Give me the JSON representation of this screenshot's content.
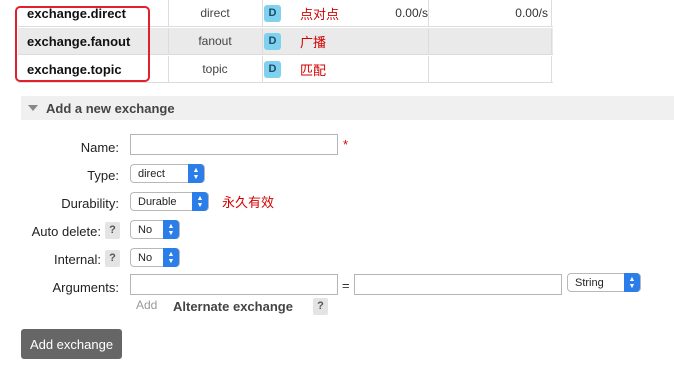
{
  "exchanges": [
    {
      "name": "exchange.direct",
      "type": "direct",
      "features": "D",
      "note": "点对点",
      "rate_in": "0.00/s",
      "rate_out": "0.00/s"
    },
    {
      "name": "exchange.fanout",
      "type": "fanout",
      "features": "D",
      "note": "广播",
      "rate_in": "",
      "rate_out": ""
    },
    {
      "name": "exchange.topic",
      "type": "topic",
      "features": "D",
      "note": "匹配",
      "rate_in": "",
      "rate_out": ""
    }
  ],
  "section": {
    "title": "Add a new exchange"
  },
  "form": {
    "name_label": "Name:",
    "name_value": "",
    "required_mark": "*",
    "type_label": "Type:",
    "type_value": "direct",
    "durability_label": "Durability:",
    "durability_value": "Durable",
    "durability_note": "永久有效",
    "auto_delete_label": "Auto delete:",
    "auto_delete_value": "No",
    "internal_label": "Internal:",
    "internal_value": "No",
    "help_mark": "?",
    "arguments_label": "Arguments:",
    "arg_key": "",
    "arg_equals": "=",
    "arg_value": "",
    "arg_type": "String",
    "add_link": "Add",
    "alternate_exchange": "Alternate exchange",
    "submit_label": "Add exchange"
  },
  "colors": {
    "annotation_red": "#d40000",
    "highlight_border": "#e0202c",
    "badge_bg": "#7fd1ef",
    "select_arrow": "#2b7de9",
    "button_bg": "#666666"
  }
}
